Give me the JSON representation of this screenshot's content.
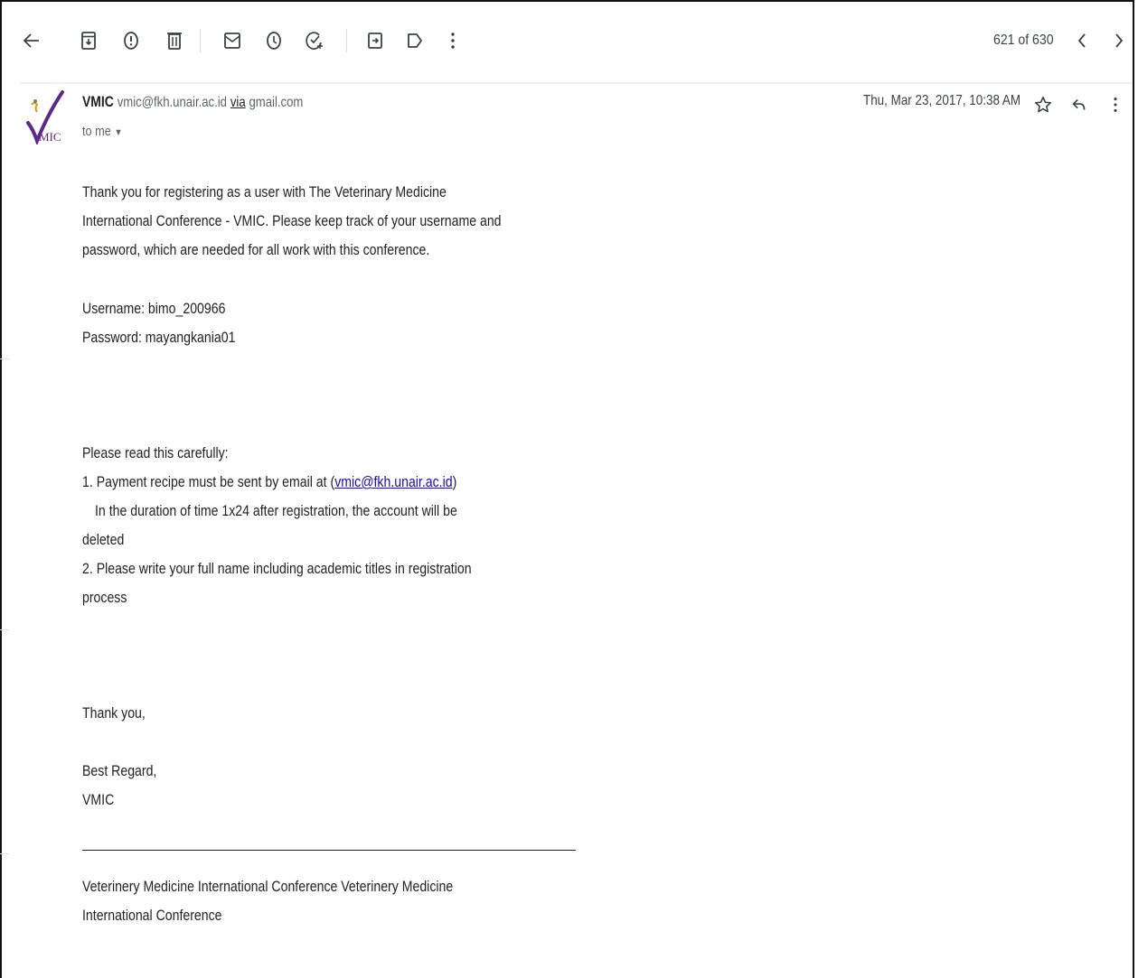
{
  "toolbar": {
    "icons": [
      "back-arrow-icon",
      "archive-icon",
      "report-spam-icon",
      "delete-icon",
      "mark-unread-icon",
      "snooze-icon",
      "add-task-icon",
      "move-to-icon",
      "label-icon",
      "more-vert-icon"
    ],
    "counter": "621 of 630"
  },
  "message": {
    "sender_name": "VMIC",
    "sender_email": "vmic@fkh.unair.ac.id",
    "via_label": "via",
    "via_domain": "gmail.com",
    "to_label": "to me",
    "date": "Thu, Mar 23, 2017, 10:38 AM"
  },
  "body": {
    "l1": "Thank you for registering as a user with The Veterinary Medicine",
    "l2": "International Conference - VMIC. Please keep track of your username and",
    "l3": "password, which are needed for all work with this conference.",
    "username": "Username: bimo_200966",
    "password": "Password: mayangkania01",
    "read_carefully": "Please read this carefully:",
    "item1_prefix": "1. Payment recipe must be sent by email at (",
    "item1_link": "vmic@fkh.unair.ac.id",
    "item1_suffix": ")",
    "item1_l2": "In the duration of time 1x24 after registration, the account will be",
    "item1_l3": "deleted",
    "item2_l1": "2. Please write your full name including academic titles in registration",
    "item2_l2": "process",
    "thanks": "Thank you,",
    "regard": "Best Regard,",
    "signature": "VMIC",
    "footer_l1": "Veterinery Medicine International Conference Veterinery Medicine",
    "footer_l2": "International Conference"
  },
  "colors": {
    "icon": "#5f6368",
    "link": "#1a0dab",
    "logo_purple": "#5b2a86"
  }
}
